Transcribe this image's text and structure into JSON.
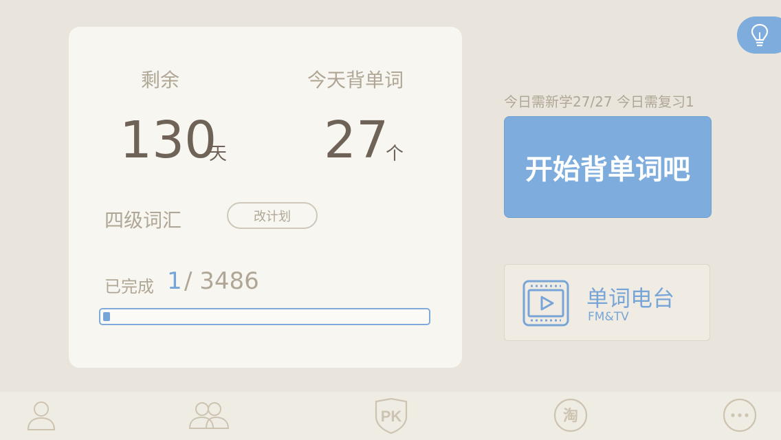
{
  "stats": {
    "remaining_label": "剩余",
    "remaining_value": "130",
    "remaining_unit": "天",
    "today_label": "今天背单词",
    "today_value": "27",
    "today_unit": "个"
  },
  "plan": {
    "vocab_name": "四级词汇",
    "change_plan_label": "改计划"
  },
  "progress": {
    "label": "已完成",
    "completed": "1",
    "total": "/ 3486",
    "fraction": 0.000287
  },
  "today_info": "今日需新学27/27  今日需复习1",
  "start_button_label": "开始背单词吧",
  "radio": {
    "title": "单词电台",
    "subtitle": "FM&TV"
  },
  "tabbar": {
    "items": [
      "profile-icon",
      "friends-icon",
      "pk-icon",
      "taobao-icon",
      "more-icon"
    ],
    "pk_glyph": "PK",
    "taobao_glyph": "淘"
  },
  "colors": {
    "accent": "#7eaddd",
    "background": "#e9e5dc",
    "card": "#f7f6f1",
    "number": "#6f6358"
  }
}
